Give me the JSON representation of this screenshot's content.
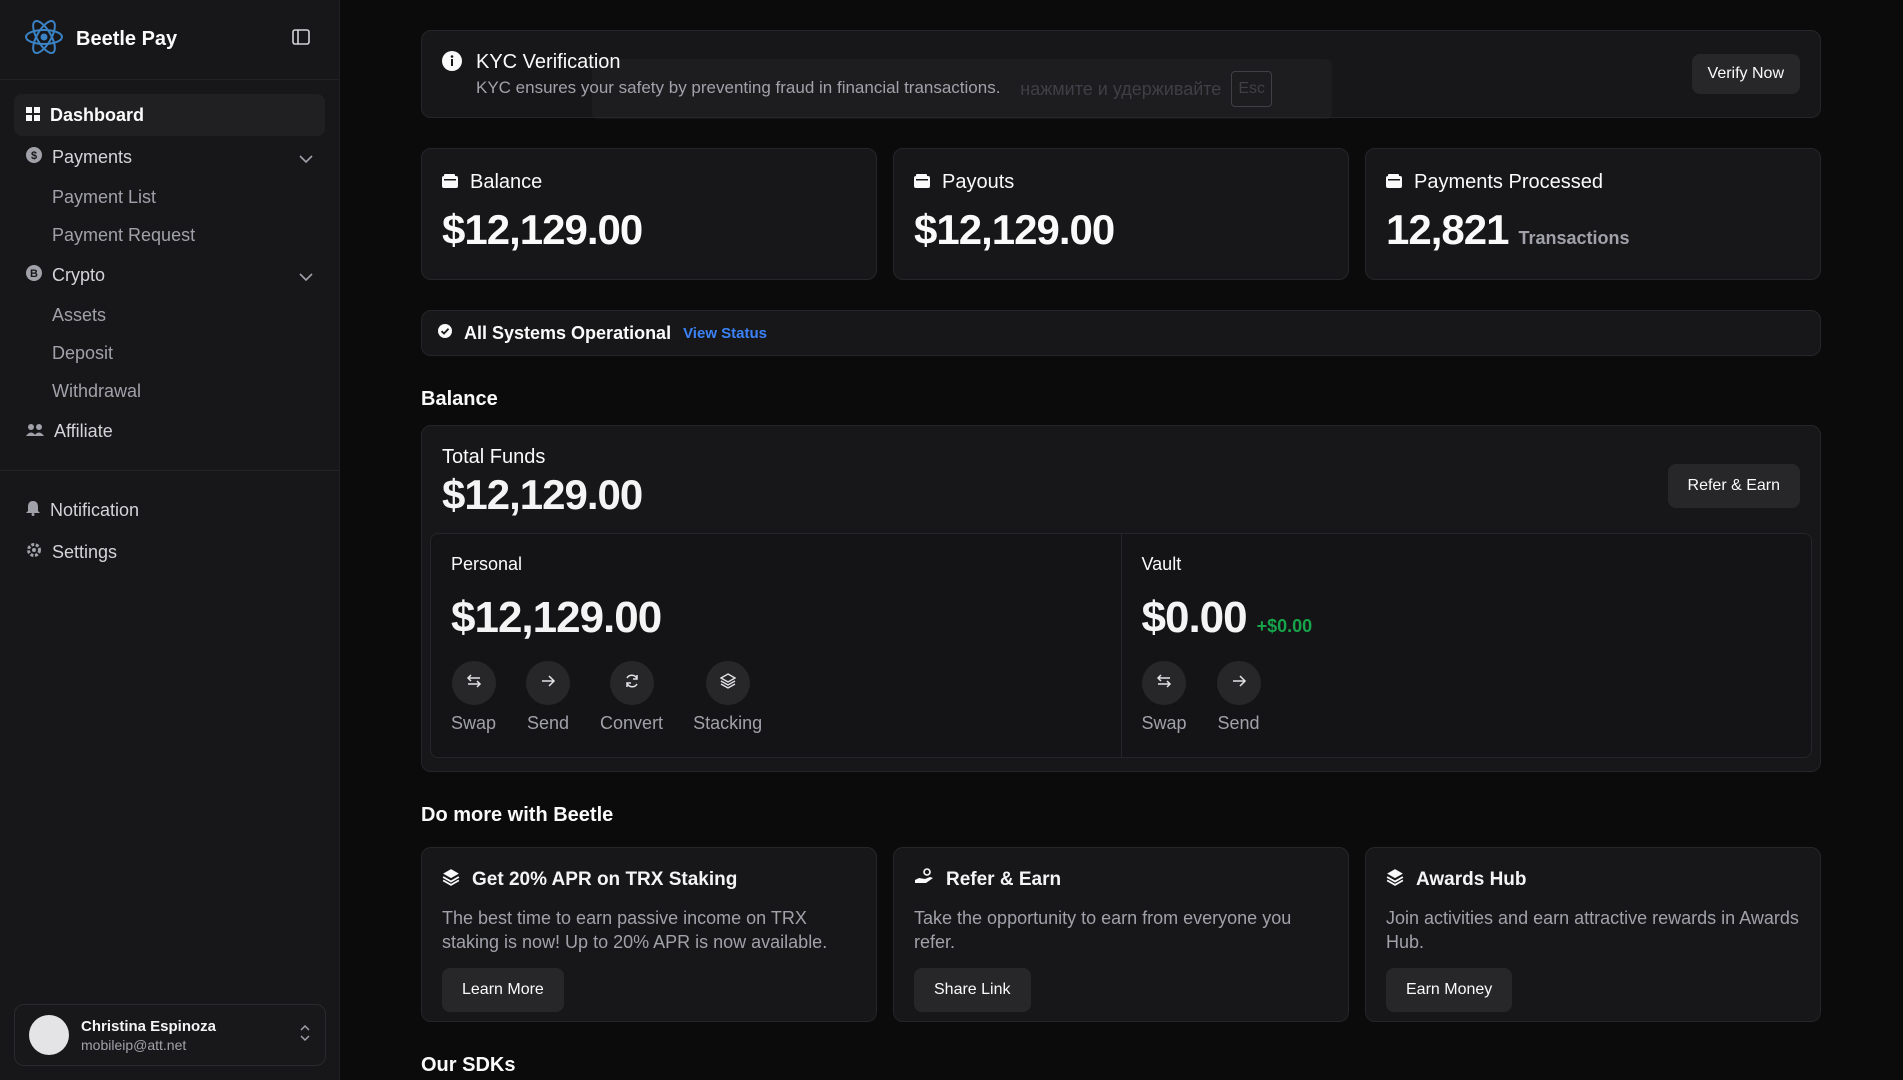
{
  "app": {
    "name": "Beetle Pay"
  },
  "sidebar": {
    "items": [
      {
        "label": "Dashboard"
      },
      {
        "label": "Payments"
      },
      {
        "label": "Payment List"
      },
      {
        "label": "Payment Request"
      },
      {
        "label": "Crypto"
      },
      {
        "label": "Assets"
      },
      {
        "label": "Deposit"
      },
      {
        "label": "Withdrawal"
      },
      {
        "label": "Affiliate"
      },
      {
        "label": "Notification"
      },
      {
        "label": "Settings"
      }
    ],
    "user": {
      "name": "Christina Espinoza",
      "email": "mobileip@att.net"
    }
  },
  "kyc": {
    "title": "KYC Verification",
    "description": "KYC ensures your safety by preventing fraud in financial transactions.",
    "button": "Verify Now",
    "ghost_text": "нажмите и удерживайте",
    "ghost_key": "Esc"
  },
  "stats": [
    {
      "label": "Balance",
      "value": "$12,129.00",
      "unit": ""
    },
    {
      "label": "Payouts",
      "value": "$12,129.00",
      "unit": ""
    },
    {
      "label": "Payments Processed",
      "value": "12,821",
      "unit": "Transactions"
    }
  ],
  "status": {
    "text": "All Systems Operational",
    "link": "View Status"
  },
  "balance": {
    "section_title": "Balance",
    "total_label": "Total Funds",
    "total_value": "$12,129.00",
    "refer_button": "Refer & Earn",
    "personal": {
      "label": "Personal",
      "value": "$12,129.00",
      "actions": [
        "Swap",
        "Send",
        "Convert",
        "Stacking"
      ]
    },
    "vault": {
      "label": "Vault",
      "value": "$0.00",
      "delta": "+$0.00",
      "actions": [
        "Swap",
        "Send"
      ]
    }
  },
  "more": {
    "section_title": "Do more with Beetle",
    "cards": [
      {
        "title": "Get 20% APR on TRX Staking",
        "description": "The best time to earn passive income on TRX staking is now! Up to 20% APR is now available.",
        "button": "Learn More"
      },
      {
        "title": "Refer & Earn",
        "description": "Take the opportunity to earn from everyone you refer.",
        "button": "Share Link"
      },
      {
        "title": "Awards Hub",
        "description": "Join activities and earn attractive rewards in Awards Hub.",
        "button": "Earn Money"
      }
    ]
  },
  "sdks": {
    "section_title": "Our SDKs"
  }
}
